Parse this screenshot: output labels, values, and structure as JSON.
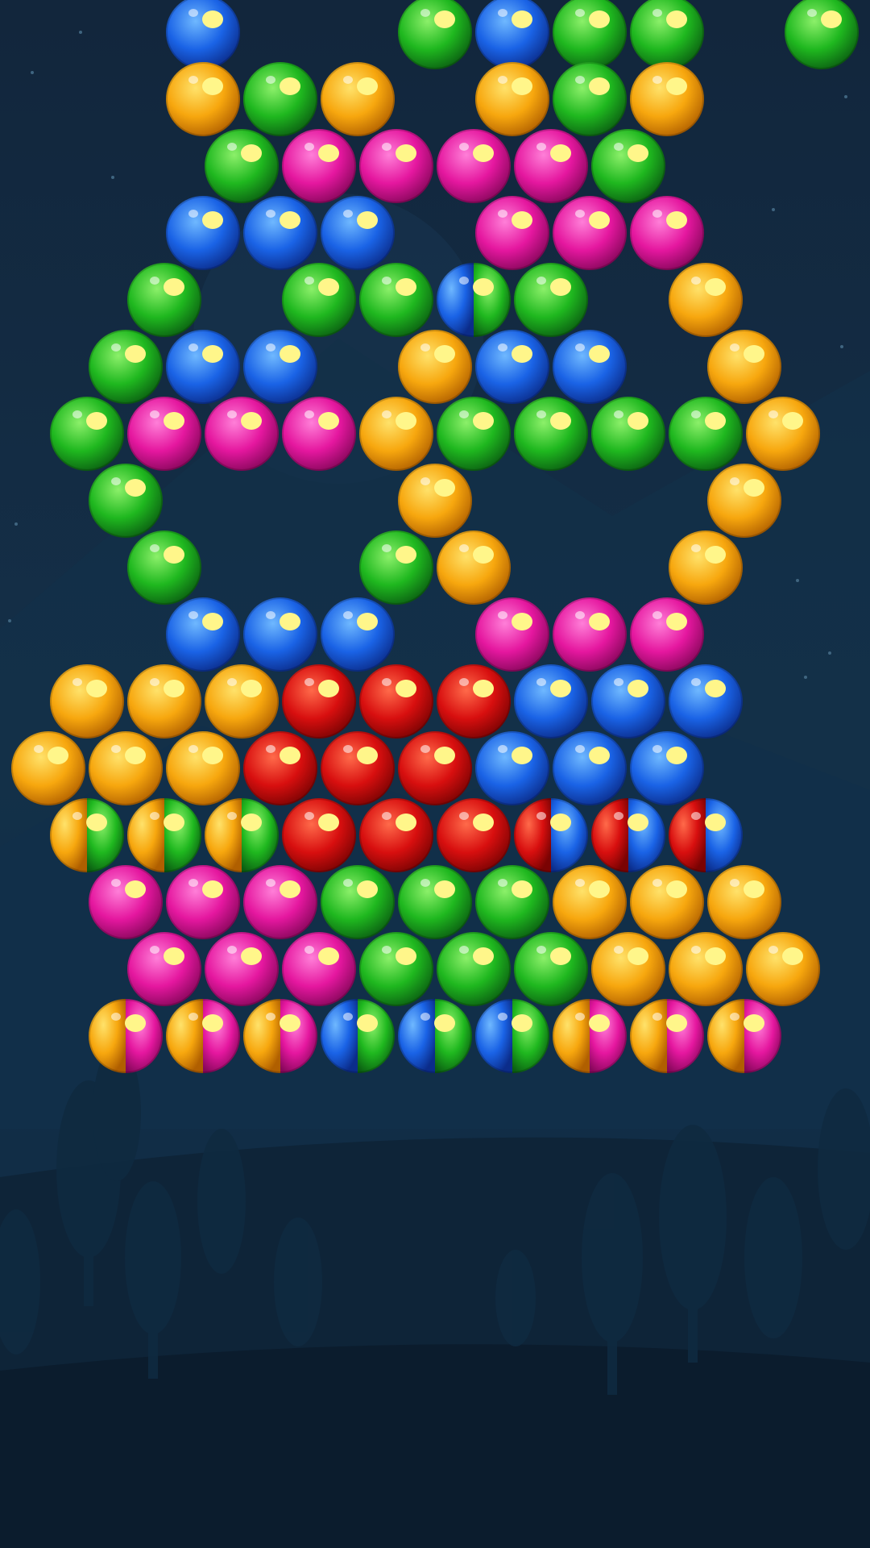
{
  "colors": {
    "Y": {
      "base": "#f7a70e",
      "light": "#ffe26a",
      "dark": "#b05f00"
    },
    "G": {
      "base": "#1fb81f",
      "light": "#8cf06a",
      "dark": "#0b5e12"
    },
    "B": {
      "base": "#1a63e6",
      "light": "#6fb8ff",
      "dark": "#0b2c8a"
    },
    "P": {
      "base": "#e5179f",
      "light": "#ff7fd8",
      "dark": "#86075a"
    },
    "R": {
      "base": "#d80f0f",
      "light": "#ff6a4a",
      "dark": "#7a0303"
    }
  },
  "board": {
    "rows": [
      {
        "cells": [
          ".",
          "B",
          ".",
          ".",
          "G",
          "B",
          "G",
          "G",
          ".",
          "G",
          "."
        ]
      },
      {
        "cells": [
          "Y",
          "G",
          "Y",
          ".",
          "Y",
          "G",
          "Y",
          "."
        ]
      },
      {
        "cells": [
          "G",
          "P",
          "P",
          "P",
          "P",
          "G",
          "."
        ]
      },
      {
        "cells": [
          "B",
          "B",
          "B",
          ".",
          "P",
          "P",
          "P",
          "."
        ]
      },
      {
        "cells": [
          "G",
          ".",
          "G",
          "G",
          "BG",
          "G",
          ".",
          "Y"
        ]
      },
      {
        "cells": [
          "G",
          "B",
          "B",
          ".",
          "Y",
          "B",
          "B",
          ".",
          "Y"
        ]
      },
      {
        "cells": [
          "G",
          "P",
          "P",
          "P",
          "Y",
          "G",
          "G",
          "G",
          "G",
          "Y"
        ]
      },
      {
        "cells": [
          "G",
          ".",
          ".",
          ".",
          "Y",
          ".",
          ".",
          ".",
          "Y"
        ]
      },
      {
        "cells": [
          "G",
          ".",
          ".",
          "G",
          "Y",
          ".",
          ".",
          "Y"
        ]
      },
      {
        "cells": [
          "B",
          "B",
          "B",
          ".",
          "P",
          "P",
          "P"
        ]
      },
      {
        "cells": [
          "Y",
          "Y",
          "Y",
          "R",
          "R",
          "R",
          "B",
          "B",
          "B"
        ]
      },
      {
        "cells": [
          "Y",
          "Y",
          "Y",
          "R",
          "R",
          "R",
          "B",
          "B",
          "B"
        ]
      },
      {
        "cells": [
          "YG",
          "YG",
          "YG",
          "R",
          "R",
          "R",
          "RB",
          "RB",
          "RB"
        ]
      },
      {
        "cells": [
          "P",
          "P",
          "P",
          "G",
          "G",
          "G",
          "Y",
          "Y",
          "Y"
        ]
      },
      {
        "cells": [
          "P",
          "P",
          "P",
          "G",
          "G",
          "G",
          "Y",
          "Y",
          "Y"
        ]
      },
      {
        "cells": [
          "YP",
          "YP",
          "YP",
          "BG",
          "BG",
          "BG",
          "YP",
          "YP",
          "YP"
        ]
      }
    ]
  }
}
